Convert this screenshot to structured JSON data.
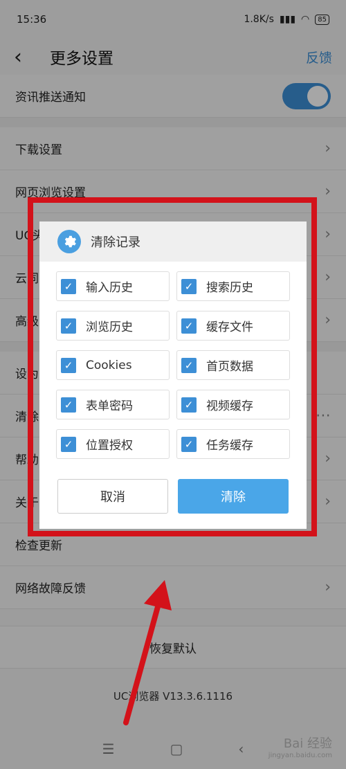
{
  "status": {
    "time": "15:36",
    "network": "1.8K/s",
    "battery": "85"
  },
  "header": {
    "title": "更多设置",
    "feedback": "反馈"
  },
  "rows": [
    {
      "label": "资讯推送通知",
      "kind": "toggle",
      "on": true
    },
    {
      "label": "下载设置",
      "kind": "chevron"
    },
    {
      "label": "网页浏览设置",
      "kind": "chevron"
    },
    {
      "label": "UC头",
      "kind": "chevron"
    },
    {
      "label": "云同",
      "kind": "chevron"
    },
    {
      "label": "高级",
      "kind": "chevron"
    },
    {
      "label": "设为",
      "kind": "toggle",
      "on": false
    },
    {
      "label": "清除",
      "kind": "more"
    },
    {
      "label": "帮助",
      "kind": "chevron"
    },
    {
      "label": "关于",
      "kind": "chevron"
    },
    {
      "label": "检查更新",
      "kind": "none"
    },
    {
      "label": "网络故障反馈",
      "kind": "chevron"
    }
  ],
  "restore_label": "恢复默认",
  "version": "UC浏览器 V13.3.6.1116",
  "dialog": {
    "title": "清除记录",
    "options": [
      {
        "label": "输入历史",
        "checked": true
      },
      {
        "label": "搜索历史",
        "checked": true
      },
      {
        "label": "浏览历史",
        "checked": true
      },
      {
        "label": "缓存文件",
        "checked": true
      },
      {
        "label": "Cookies",
        "checked": true
      },
      {
        "label": "首页数据",
        "checked": true
      },
      {
        "label": "表单密码",
        "checked": true
      },
      {
        "label": "视频缓存",
        "checked": true
      },
      {
        "label": "位置授权",
        "checked": true
      },
      {
        "label": "任务缓存",
        "checked": true
      }
    ],
    "cancel": "取消",
    "clear": "清除"
  },
  "watermark": {
    "brand": "Bai 经验",
    "url": "jingyan.baidu.com"
  },
  "colors": {
    "accent": "#3d8fd6",
    "clear_button": "#4aa6e8",
    "annotation": "#d3121a"
  }
}
